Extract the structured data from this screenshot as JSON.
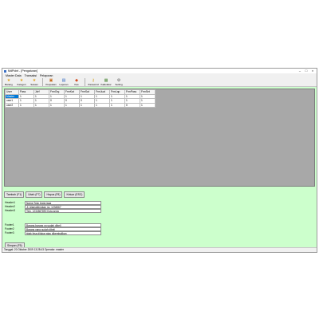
{
  "window": {
    "title": "MdPoint - [Pengaturan]"
  },
  "menu": [
    "Master Data",
    "Transaksi",
    "Pelaporan"
  ],
  "toolbar": [
    {
      "label": "Barang",
      "icon": "star-icon",
      "color": "#e2a21b"
    },
    {
      "label": "Kategori",
      "icon": "star-icon",
      "color": "#e2a21b"
    },
    {
      "label": "Satuan",
      "icon": "star-icon",
      "color": "#e2a21b"
    },
    {
      "label": "Penjualan",
      "icon": "cart-icon",
      "color": "#c86b1a"
    },
    {
      "label": "Laporan",
      "icon": "report-icon",
      "color": "#3a6fc4"
    },
    {
      "label": "Kas",
      "icon": "cash-icon",
      "color": "#d24b1e"
    },
    {
      "label": "Password",
      "icon": "key-icon",
      "color": "#d6a42a"
    },
    {
      "label": "Kalkulator",
      "icon": "calculator-icon",
      "color": "#4f8a3b"
    },
    {
      "label": "Setting",
      "icon": "gear-icon",
      "color": "#555555"
    }
  ],
  "table": {
    "columns": [
      "User",
      "Pass",
      "Jdrf",
      "FrmOrg",
      "FrmKat",
      "FrmSat",
      "FrmJual",
      "FrmLap",
      "FrmPass",
      "FrmSet"
    ],
    "rows": [
      [
        "Master",
        "1",
        "1",
        "1",
        "1",
        "1",
        "1",
        "1",
        "1",
        "1"
      ],
      [
        "user1",
        "1",
        "1",
        "0",
        "0",
        "0",
        "1",
        "1",
        "1",
        "1"
      ],
      [
        "user2",
        "1",
        "1",
        "1",
        "1",
        "1",
        "1",
        "1",
        "0",
        "1"
      ]
    ]
  },
  "tabs": [
    "Tambah (F1)",
    "Ubah (F7)",
    "Hapus (F8)",
    "Keluar (ESC)"
  ],
  "header_fields": [
    {
      "label": "Header1",
      "value": "Nama Toko Anda jaaa"
    },
    {
      "label": "Header2",
      "value": "Jl. Alamatlengkap no. 1234567"
    },
    {
      "label": "Header3",
      "value": "Telp. 1234567890 Kota anda"
    }
  ],
  "footer_fields": [
    {
      "label": "Footer1",
      "value": "Barang-barang yg sudah dibeli"
    },
    {
      "label": "Footer2",
      "value": "Barang yang sudah dibeli"
    },
    {
      "label": "Footer3",
      "value": "tidak bisa ditukar atau dikembalikan"
    }
  ],
  "save_button": "Simpan (F5)",
  "status_bar": "Tanggal: 20 Oktober 2009 13:28:43  Operator: master"
}
